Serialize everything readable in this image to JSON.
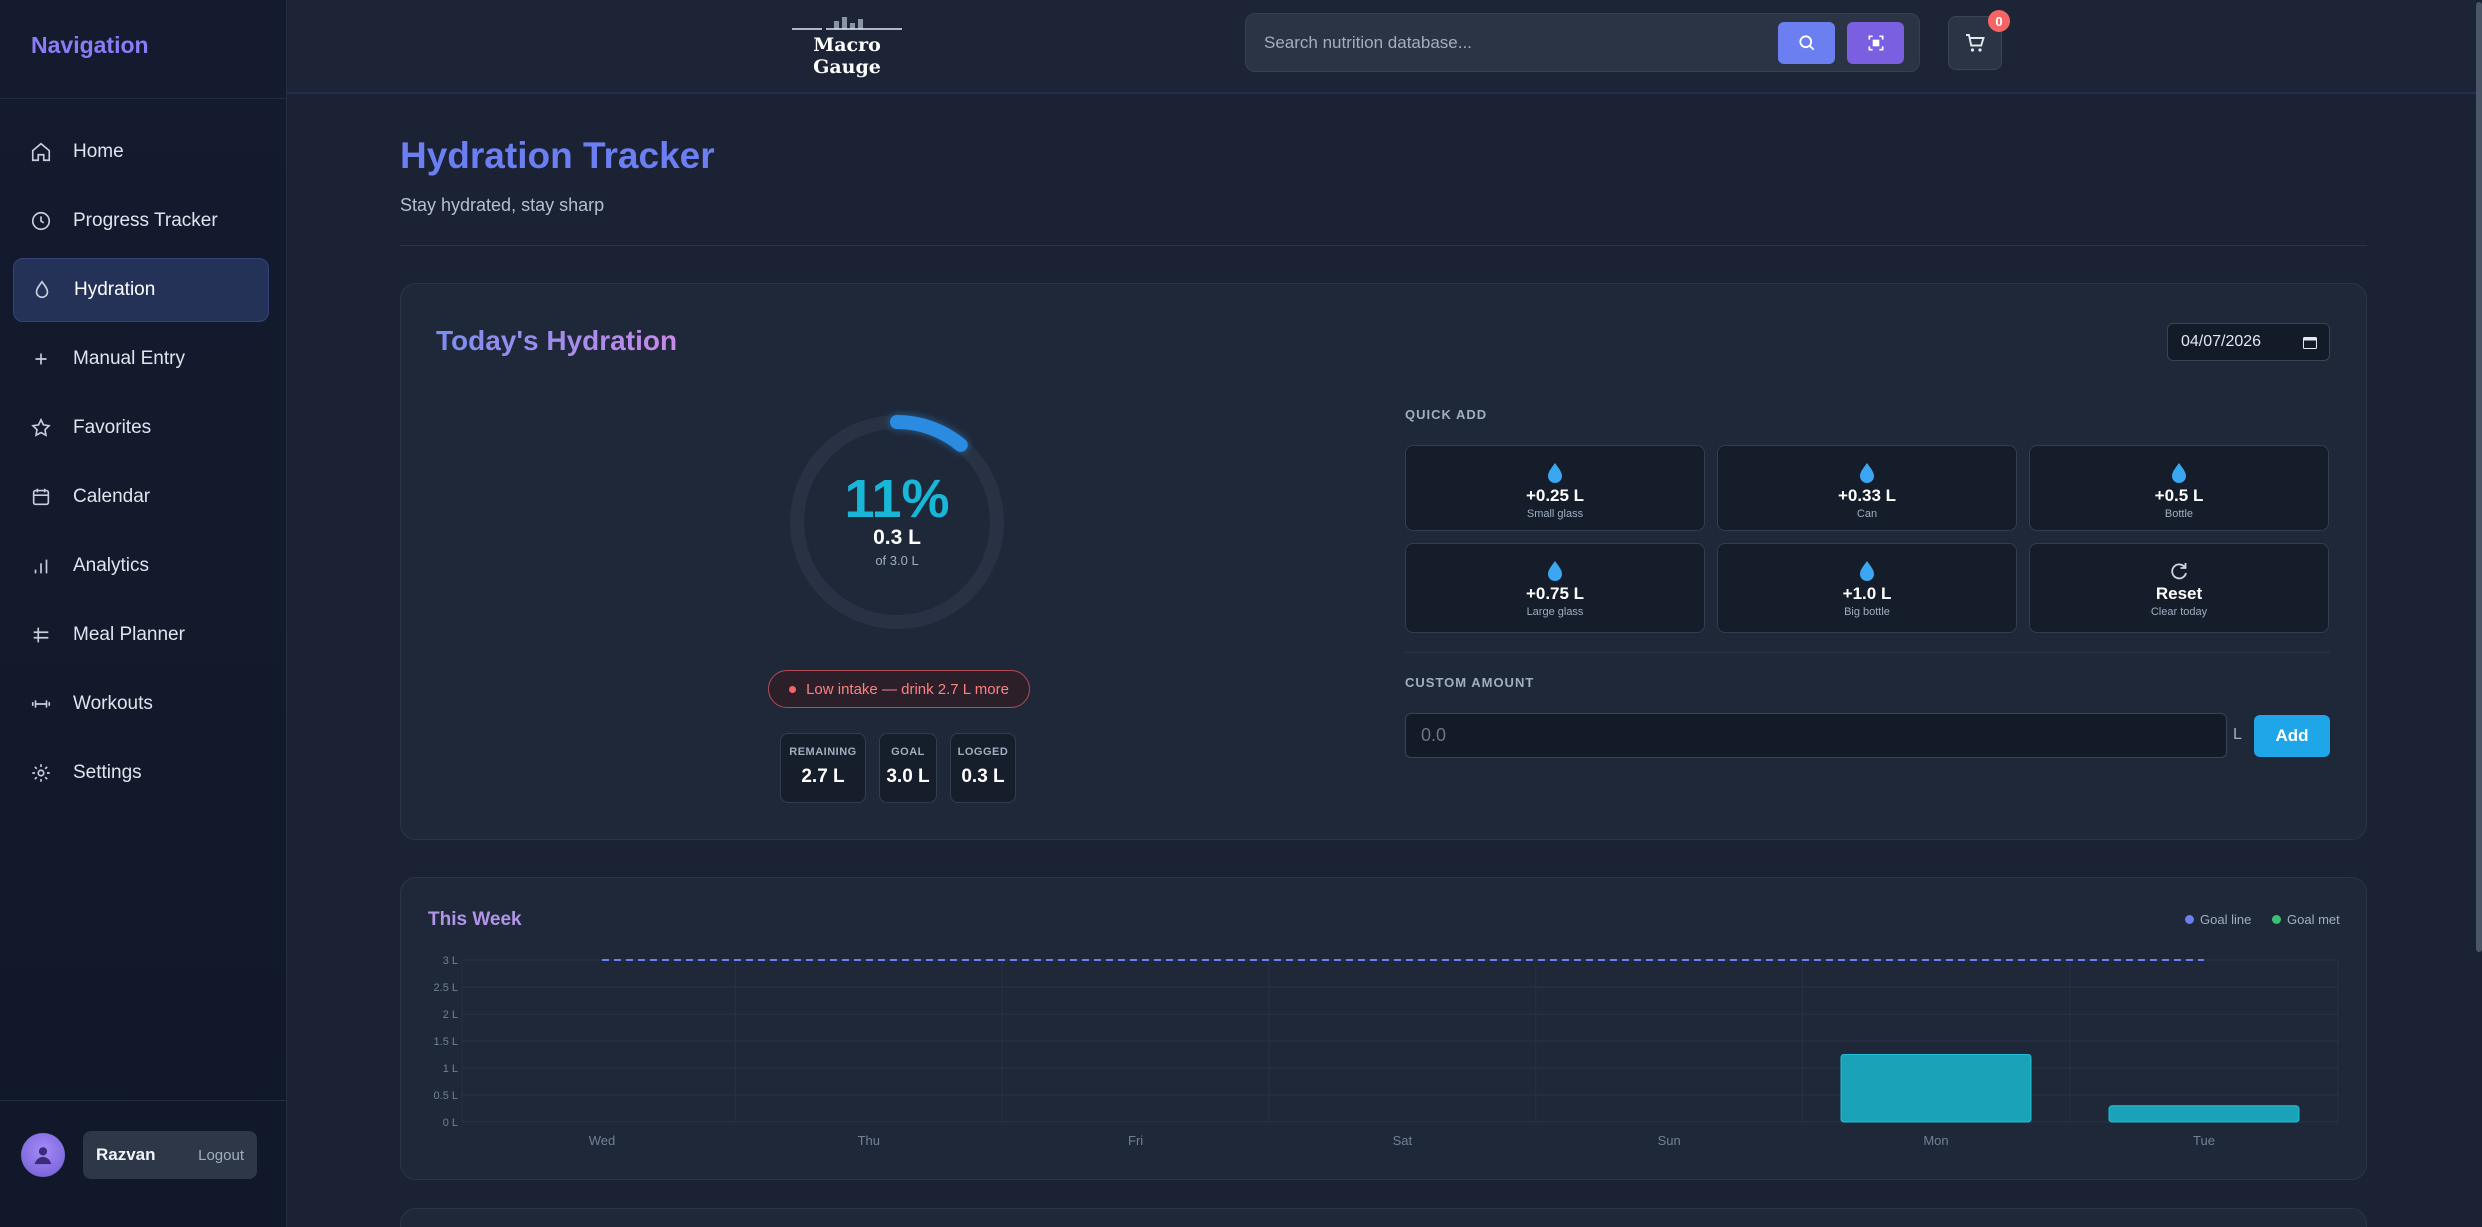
{
  "sidebar": {
    "title": "Navigation",
    "items": [
      {
        "label": "Home",
        "icon": "home-icon",
        "active": false
      },
      {
        "label": "Progress Tracker",
        "icon": "clock-icon",
        "active": false
      },
      {
        "label": "Hydration",
        "icon": "droplet-icon",
        "active": true
      },
      {
        "label": "Manual Entry",
        "icon": "plus-icon",
        "active": false
      },
      {
        "label": "Favorites",
        "icon": "star-icon",
        "active": false
      },
      {
        "label": "Calendar",
        "icon": "calendar-icon",
        "active": false
      },
      {
        "label": "Analytics",
        "icon": "bar-chart-icon",
        "active": false
      },
      {
        "label": "Meal Planner",
        "icon": "utensils-icon",
        "active": false
      },
      {
        "label": "Workouts",
        "icon": "dumbbell-icon",
        "active": false
      },
      {
        "label": "Settings",
        "icon": "gear-icon",
        "active": false
      }
    ],
    "user": {
      "name": "Razvan",
      "logout_label": "Logout"
    }
  },
  "header": {
    "logo_text": "Macro Gauge",
    "search_placeholder": "Search nutrition database...",
    "cart_count": "0"
  },
  "page": {
    "title": "Hydration Tracker",
    "subtitle": "Stay hydrated, stay sharp"
  },
  "today": {
    "title": "Today's Hydration",
    "date": "04/07/2026",
    "percent_label": "11%",
    "progress_fraction": 0.11,
    "logged_label": "0.3 L",
    "goal_label": "of 3.0 L",
    "alert": "Low intake — drink 2.7 L more",
    "stats": [
      {
        "label": "REMAINING",
        "value": "2.7 L"
      },
      {
        "label": "GOAL",
        "value": "3.0 L"
      },
      {
        "label": "LOGGED",
        "value": "0.3 L"
      }
    ],
    "quick_add_label": "QUICK ADD",
    "quick_add": [
      {
        "amount": "+0.25 L",
        "desc": "Small glass"
      },
      {
        "amount": "+0.33 L",
        "desc": "Can"
      },
      {
        "amount": "+0.5 L",
        "desc": "Bottle"
      },
      {
        "amount": "+0.75 L",
        "desc": "Large glass"
      },
      {
        "amount": "+1.0 L",
        "desc": "Big bottle"
      },
      {
        "amount": "Reset",
        "desc": "Clear today"
      }
    ],
    "custom_label": "CUSTOM AMOUNT",
    "custom_placeholder": "0.0",
    "custom_unit": "L",
    "add_label": "Add"
  },
  "week": {
    "title": "This Week",
    "legend": [
      {
        "label": "Goal line",
        "color": "#6b7ff0"
      },
      {
        "label": "Goal met",
        "color": "#38c172"
      }
    ]
  },
  "chart_data": {
    "type": "bar",
    "categories": [
      "Wed",
      "Thu",
      "Fri",
      "Sat",
      "Sun",
      "Mon",
      "Tue"
    ],
    "values": [
      0,
      0,
      0,
      0,
      0,
      1.25,
      0.3
    ],
    "goal": 3.0,
    "y_ticks": [
      "0 L",
      "0.5 L",
      "1 L",
      "1.5 L",
      "2 L",
      "2.5 L",
      "3 L"
    ],
    "ylim": [
      0,
      3
    ],
    "grid": true,
    "bar_color": "#1aa3b8",
    "legend_position": "top-right"
  },
  "colors": {
    "accent": "#6c7ff2",
    "ring": "#2b8be0",
    "alert": "#fc8181"
  }
}
